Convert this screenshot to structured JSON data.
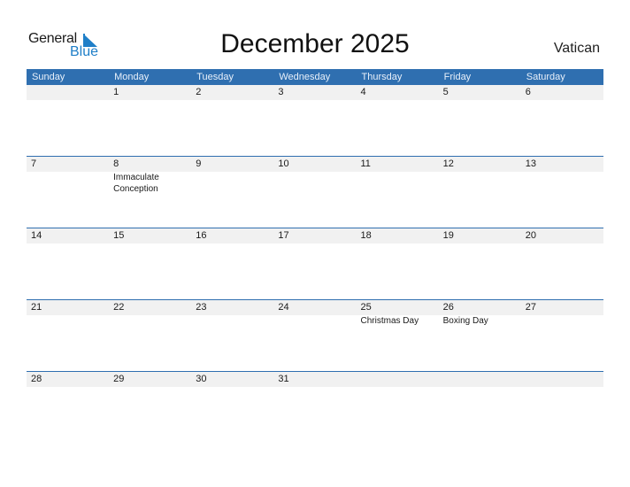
{
  "logo": {
    "general": "General",
    "blue": "Blue"
  },
  "title": "December 2025",
  "country": "Vatican",
  "weekdays": [
    "Sunday",
    "Monday",
    "Tuesday",
    "Wednesday",
    "Thursday",
    "Friday",
    "Saturday"
  ],
  "weeks": [
    [
      {
        "day": ""
      },
      {
        "day": "1"
      },
      {
        "day": "2"
      },
      {
        "day": "3"
      },
      {
        "day": "4"
      },
      {
        "day": "5"
      },
      {
        "day": "6"
      }
    ],
    [
      {
        "day": "7"
      },
      {
        "day": "8",
        "holiday": "Immaculate Conception"
      },
      {
        "day": "9"
      },
      {
        "day": "10"
      },
      {
        "day": "11"
      },
      {
        "day": "12"
      },
      {
        "day": "13"
      }
    ],
    [
      {
        "day": "14"
      },
      {
        "day": "15"
      },
      {
        "day": "16"
      },
      {
        "day": "17"
      },
      {
        "day": "18"
      },
      {
        "day": "19"
      },
      {
        "day": "20"
      }
    ],
    [
      {
        "day": "21"
      },
      {
        "day": "22"
      },
      {
        "day": "23"
      },
      {
        "day": "24"
      },
      {
        "day": "25",
        "holiday": "Christmas Day"
      },
      {
        "day": "26",
        "holiday": "Boxing Day"
      },
      {
        "day": "27"
      }
    ],
    [
      {
        "day": "28"
      },
      {
        "day": "29"
      },
      {
        "day": "30"
      },
      {
        "day": "31"
      },
      {
        "day": ""
      },
      {
        "day": ""
      },
      {
        "day": ""
      }
    ]
  ],
  "colors": {
    "header_bg": "#2f6fb0",
    "brand_blue": "#1f7fc8",
    "date_strip": "#f1f1f1"
  }
}
